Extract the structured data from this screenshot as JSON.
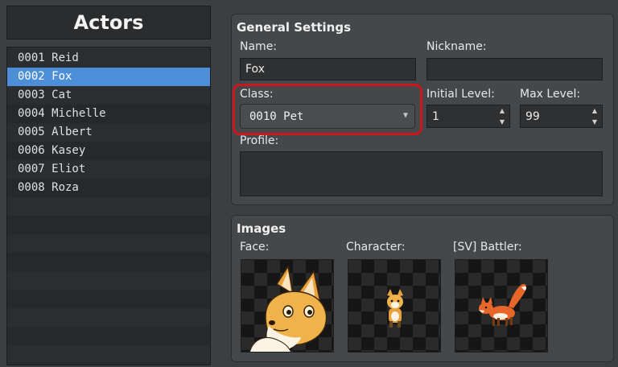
{
  "actors_panel": {
    "title": "Actors",
    "items": [
      {
        "label": "0001 Reid"
      },
      {
        "label": "0002 Fox"
      },
      {
        "label": "0003 Cat"
      },
      {
        "label": "0004 Michelle"
      },
      {
        "label": "0005 Albert"
      },
      {
        "label": "0006 Kasey"
      },
      {
        "label": "0007 Eliot"
      },
      {
        "label": "0008 Roza"
      }
    ],
    "selected_index": 1
  },
  "general_settings": {
    "title": "General Settings",
    "name_label": "Name:",
    "name_value": "Fox",
    "nickname_label": "Nickname:",
    "nickname_value": "",
    "class_label": "Class:",
    "class_value": "0010 Pet",
    "initial_level_label": "Initial Level:",
    "initial_level_value": "1",
    "max_level_label": "Max Level:",
    "max_level_value": "99",
    "profile_label": "Profile:",
    "profile_value": ""
  },
  "images": {
    "title": "Images",
    "face_label": "Face:",
    "character_label": "Character:",
    "battler_label": "[SV] Battler:"
  },
  "icons": {
    "dropdown_arrow": "chevron-down-icon",
    "spin_up": "spin-up-icon",
    "spin_down": "spin-down-icon"
  },
  "colors": {
    "selection": "#4d8ed9",
    "highlight": "#d0141e",
    "fox_orange": "#e8a23c"
  }
}
